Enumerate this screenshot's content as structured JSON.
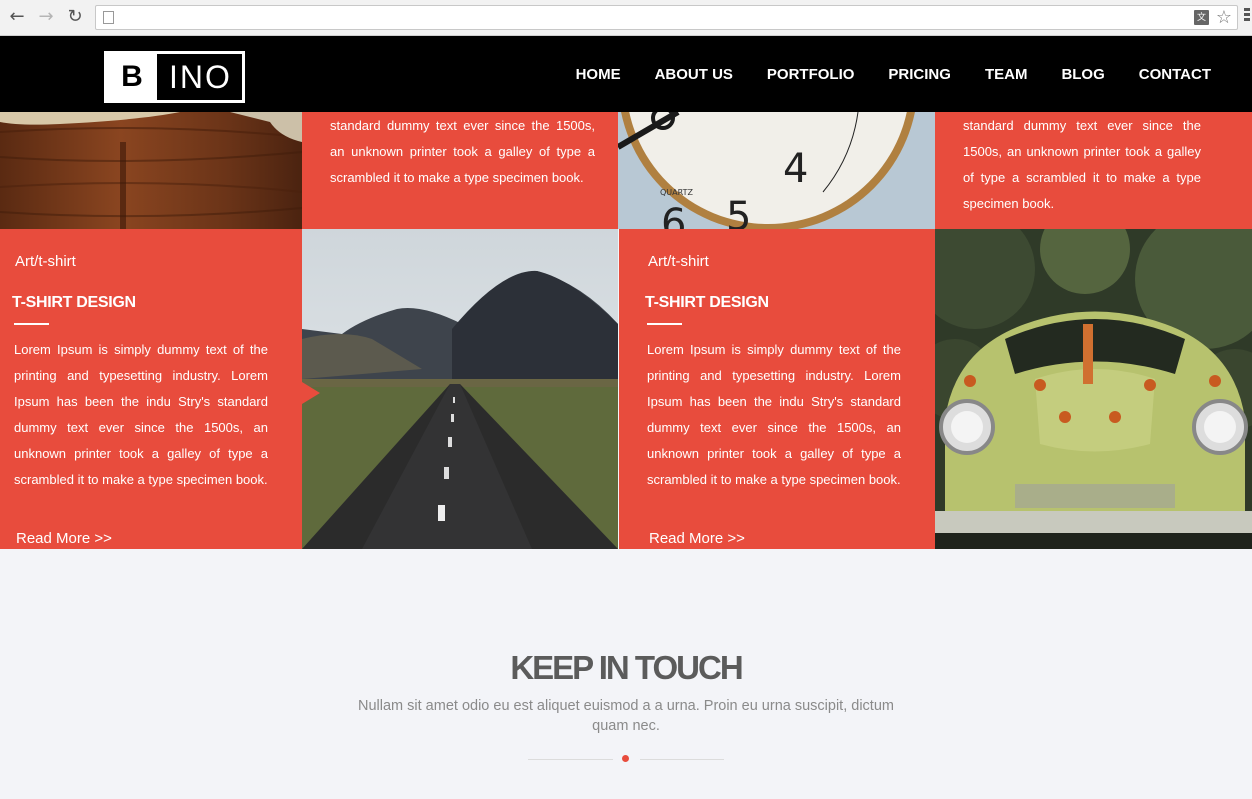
{
  "browser": {
    "back_icon": "arrow-left",
    "forward_icon": "arrow-right",
    "reload_icon": "reload",
    "url": "",
    "colors": {
      "chrome": "#f2f2f2"
    }
  },
  "header": {
    "logo_letter": "B",
    "logo_rest": "INO",
    "nav": [
      "HOME",
      "ABOUT US",
      "PORTFOLIO",
      "PRICING",
      "TEAM",
      "BLOG",
      "CONTACT"
    ]
  },
  "portfolio": {
    "top_left_text": "standard dummy text ever since the 1500s, an unknown printer took a galley of type a scrambled it to make a type specimen book.",
    "top_right_text": "standard dummy text ever since the 1500s, an unknown printer took a galley of type a scrambled it to make a type specimen book.",
    "cards": [
      {
        "category": "Art/t-shirt",
        "title": "T-SHIRT DESIGN",
        "body": "Lorem Ipsum is simply dummy text of the printing and typesetting industry. Lorem Ipsum has been the indu Stry's standard dummy text ever since the 1500s, an unknown printer took a galley of type a scrambled it to make a type specimen book.",
        "read_more": "Read More >>"
      },
      {
        "category": "Art/t-shirt",
        "title": "T-SHIRT DESIGN",
        "body": "Lorem Ipsum is simply dummy text of the printing and typesetting industry. Lorem Ipsum has been the indu Stry's standard dummy text ever since the 1500s, an unknown printer took a galley of type a scrambled it to make a type specimen book.",
        "read_more": "Read More >>"
      }
    ],
    "clock_label": "QUARTZ",
    "clock_numbers": [
      "4",
      "5",
      "6"
    ],
    "accent_color": "#e84c3d"
  },
  "keep_in_touch": {
    "title": "KEEP IN TOUCH",
    "subtitle": "Nullam sit amet odio eu est aliquet euismod a a urna. Proin eu urna suscipit, dictum quam nec."
  }
}
